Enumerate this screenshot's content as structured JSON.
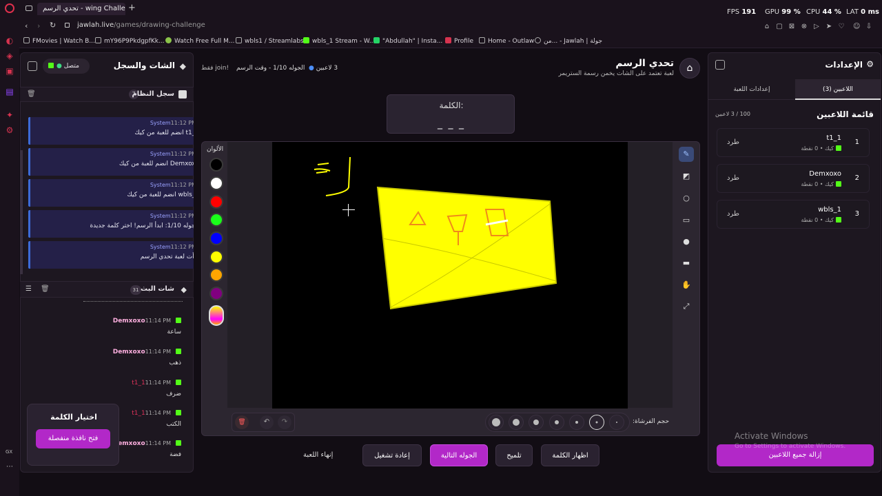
{
  "browser": {
    "tab_title": "تحدي الرسم - wing Challenge",
    "url_host": "jawlah.live",
    "url_path": "/games/drawing-challenge",
    "bookmarks": [
      "FMovies | Watch B...",
      "mY96P9PkdgpfKk...",
      "Watch Free Full M...",
      "wbls1 / Streamlabs",
      "wbls_1 Stream - W...",
      "\"Abdullah\" | Insta...",
      "Profile",
      "Home - Outlaw",
      "من... - Jawlah | جولة"
    ],
    "stats": {
      "fps_label": "FPS",
      "fps": "191",
      "gpu_label": "GPU",
      "gpu": "99 %",
      "cpu_label": "CPU",
      "cpu": "44 %",
      "lat_label": "LAT",
      "lat": "0 ms"
    },
    "gx_label": "GX"
  },
  "left": {
    "title": "الشات والسجل",
    "connected": "متصل",
    "system_log": {
      "title": "سجل النظام",
      "count": "7",
      "messages": [
        {
          "sender": "System",
          "time": "11:12 PM",
          "text": "t1_1 انضم للعبة من كيك"
        },
        {
          "sender": "System",
          "time": "11:12 PM",
          "text": "Demxoxo انضم للعبة من كيك"
        },
        {
          "sender": "System",
          "time": "11:12 PM",
          "text": "wbls_1 انضم للعبة من كيك"
        },
        {
          "sender": "System",
          "time": "11:12 PM",
          "text": "الجوله 1/10: ابدأ الرسم! اختر كلمة جديدة"
        },
        {
          "sender": "System",
          "time": "11:12 PM",
          "text": "بدأت لعبة تحدي الرسم"
        }
      ]
    },
    "live_chat": {
      "title": "شات البث",
      "count": "31",
      "messages": [
        {
          "user": "Demxoxo",
          "time": "11:14 PM",
          "text": "ساعة",
          "color": "#ffb0e0"
        },
        {
          "user": "Demxoxo",
          "time": "11:14 PM",
          "text": "ذهب",
          "color": "#ffb0e0"
        },
        {
          "user": "t1_1",
          "time": "11:14 PM",
          "text": "ضرف",
          "color": "#e0325a"
        },
        {
          "user": "t1_1",
          "time": "11:14 PM",
          "text": "الكتب",
          "color": "#e0325a"
        },
        {
          "user": "Demxoxo",
          "time": "11:14 PM",
          "text": "فضة",
          "color": "#ffb0e0"
        }
      ]
    },
    "word_pick": {
      "title": "اختيار الكلمة",
      "button": "فتح نافذة منفصلة"
    }
  },
  "header": {
    "title": "تحدي الرسم",
    "subtitle": "لعبة تعتمد على الشات يخمن رسمة الستريمر",
    "players": "3 لاعبين",
    "round": "الجوله 1/10 - وقت الرسم",
    "join": "!join فقط"
  },
  "word": {
    "label": "الكلمة:",
    "value": "_ _ _"
  },
  "canvas": {
    "colors_label": "الألوان",
    "colors": [
      "#000000",
      "#ffffff",
      "#ff0000",
      "#1aff1a",
      "#0000ff",
      "#ffff00",
      "#ffa500",
      "#800080"
    ],
    "brush_label": "حجم الفرشاة:",
    "tools": [
      "pencil-icon",
      "eraser-icon",
      "circle-icon",
      "rectangle-icon",
      "filled-circle-icon",
      "filled-rectangle-icon",
      "fill-icon",
      "line-icon"
    ]
  },
  "actions": {
    "end": "إنهاء اللعبة",
    "restart": "إعادة تشغيل",
    "next": "الجوله التالية",
    "hint": "تلميح",
    "show_word": "اظهار الكلمة"
  },
  "right": {
    "title": "الإعدادات",
    "tab_players": "اللاعبين (3)",
    "tab_settings": "إعدادات اللعبة",
    "list_title": "قائمة اللاعبين",
    "list_count": "100 / 3 لاعبين",
    "players": [
      {
        "rank": "1",
        "name": "t1_1",
        "pts": "كيك • 0 نقطة",
        "kick": "طرد"
      },
      {
        "rank": "2",
        "name": "Demxoxo",
        "pts": "كيك • 0 نقطة",
        "kick": "طرد"
      },
      {
        "rank": "3",
        "name": "wbls_1",
        "pts": "كيك • 0 نقطة",
        "kick": "طرد"
      }
    ],
    "remove_all": "إزالة جميع اللاعبين"
  },
  "watermark": {
    "line1": "Activate Windows",
    "line2": "Go to Settings to activate Windows."
  }
}
